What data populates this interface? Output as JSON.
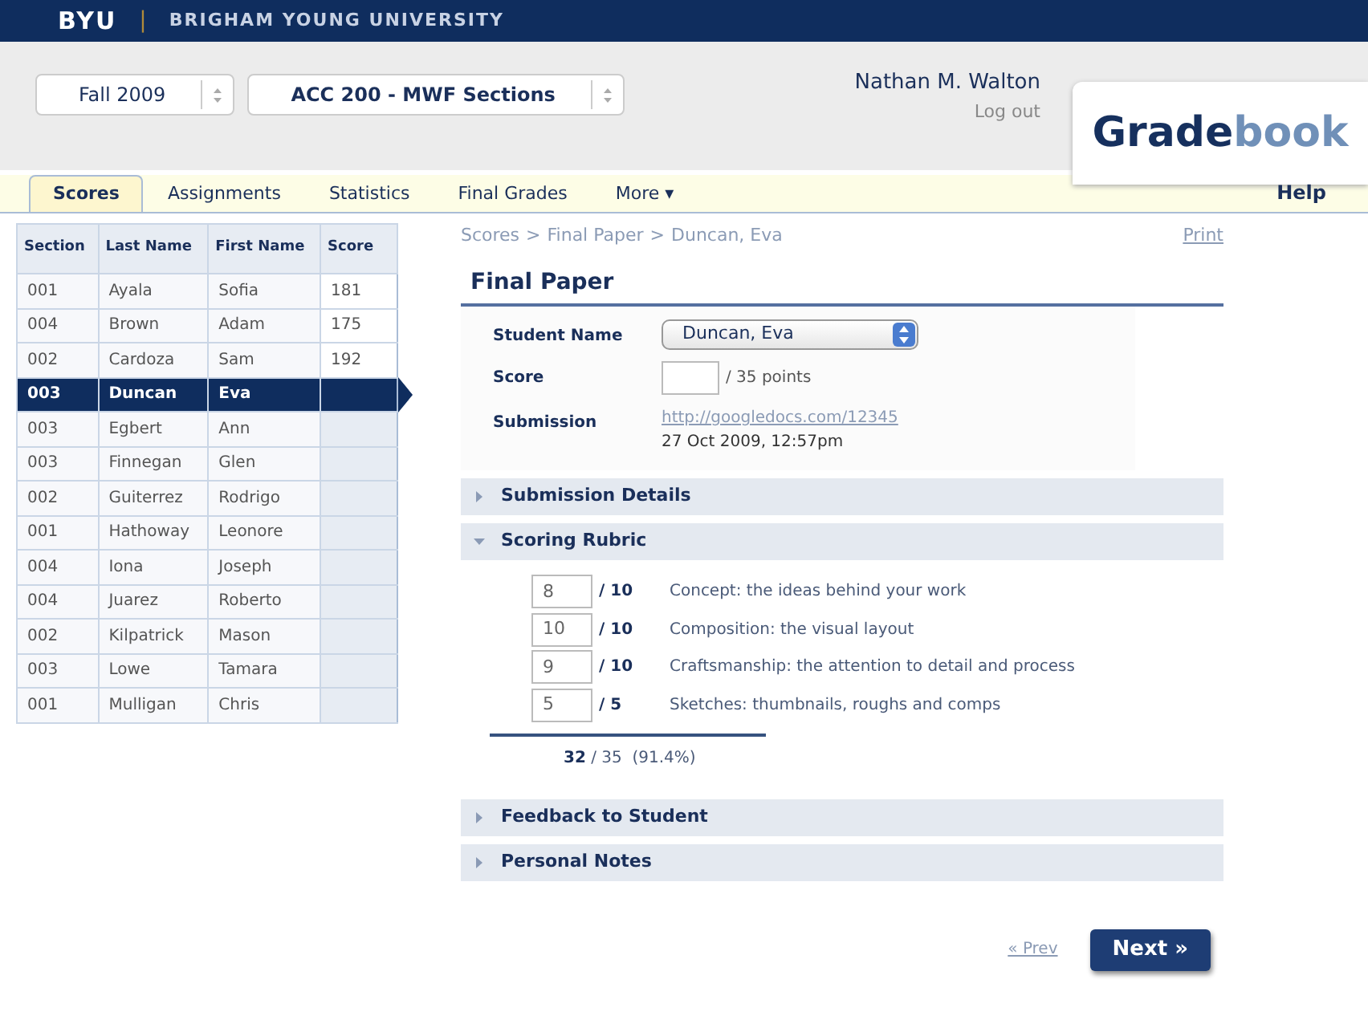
{
  "top_bar": {
    "logo": "BYU",
    "divider": "|",
    "university": "BRIGHAM YOUNG UNIVERSITY"
  },
  "header": {
    "term_select": "Fall 2009",
    "course_select": "ACC 200 - MWF Sections",
    "user_name": "Nathan M. Walton",
    "logout": "Log out",
    "app_title_strong": "Grade",
    "app_title_light": "book"
  },
  "tabs": [
    {
      "label": "Scores",
      "selected": true
    },
    {
      "label": "Assignments",
      "selected": false
    },
    {
      "label": "Statistics",
      "selected": false
    },
    {
      "label": "Final Grades",
      "selected": false
    },
    {
      "label": "More ▾",
      "selected": false
    }
  ],
  "help": "Help",
  "table": {
    "columns": [
      "Section",
      "Last Name",
      "First Name",
      "Score"
    ],
    "rows": [
      {
        "section": "001",
        "last": "Ayala",
        "first": "Sofia",
        "score": "181",
        "selected": false
      },
      {
        "section": "004",
        "last": "Brown",
        "first": "Adam",
        "score": "175",
        "selected": false
      },
      {
        "section": "002",
        "last": "Cardoza",
        "first": "Sam",
        "score": "192",
        "selected": false
      },
      {
        "section": "003",
        "last": "Duncan",
        "first": "Eva",
        "score": "",
        "selected": true
      },
      {
        "section": "003",
        "last": "Egbert",
        "first": "Ann",
        "score": "",
        "selected": false
      },
      {
        "section": "003",
        "last": "Finnegan",
        "first": "Glen",
        "score": "",
        "selected": false
      },
      {
        "section": "002",
        "last": "Guiterrez",
        "first": "Rodrigo",
        "score": "",
        "selected": false
      },
      {
        "section": "001",
        "last": "Hathoway",
        "first": "Leonore",
        "score": "",
        "selected": false
      },
      {
        "section": "004",
        "last": "Iona",
        "first": "Joseph",
        "score": "",
        "selected": false
      },
      {
        "section": "004",
        "last": "Juarez",
        "first": "Roberto",
        "score": "",
        "selected": false
      },
      {
        "section": "002",
        "last": "Kilpatrick",
        "first": "Mason",
        "score": "",
        "selected": false
      },
      {
        "section": "003",
        "last": "Lowe",
        "first": "Tamara",
        "score": "",
        "selected": false
      },
      {
        "section": "001",
        "last": "Mulligan",
        "first": "Chris",
        "score": "",
        "selected": false
      }
    ]
  },
  "breadcrumb": {
    "links": [
      "Scores",
      "Final Paper"
    ],
    "separator": ">",
    "current": "Duncan, Eva"
  },
  "print": "Print",
  "title": "Final Paper",
  "form": {
    "student_label": "Student Name",
    "student_value": "Duncan, Eva",
    "score_label": "Score",
    "score_suffix": "/ 35 points",
    "submission_label": "Submission",
    "submission_link": "http://googledocs.com/12345",
    "submission_date": "27 Oct 2009, 12:57pm"
  },
  "sections": [
    {
      "title": "Submission Details",
      "expanded": false
    },
    {
      "title": "Scoring Rubric",
      "expanded": true
    },
    {
      "title": "Feedback to Student",
      "expanded": false
    },
    {
      "title": "Personal Notes",
      "expanded": false
    }
  ],
  "rubric": [
    {
      "value": "8",
      "max": "/ 10",
      "description": "Concept: the ideas behind your work"
    },
    {
      "value": "10",
      "max": "/ 10",
      "description": "Composition: the visual layout"
    },
    {
      "value": "9",
      "max": "/ 10",
      "description": "Craftsmanship: the attention to detail and process"
    },
    {
      "value": "5",
      "max": "/ 5",
      "description": "Sketches: thumbnails, roughs and comps"
    }
  ],
  "total": "**32** / 35  (91.4%)",
  "pager": {
    "prev": "« Prev",
    "next": "Next »"
  }
}
